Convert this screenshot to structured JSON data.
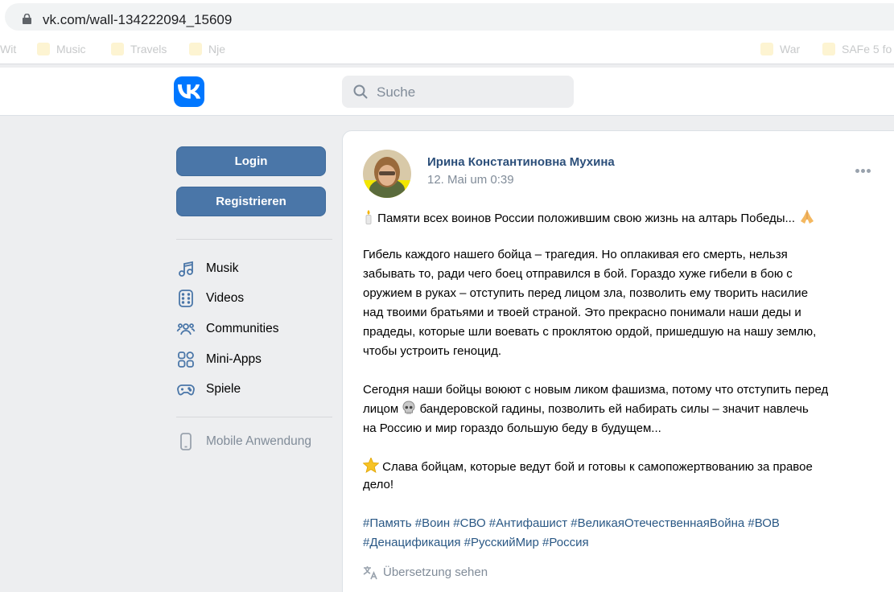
{
  "browser": {
    "url": "vk.com/wall-134222094_15609",
    "bookmarks": [
      "Wit",
      "Music",
      "Travels",
      "Nje",
      "War",
      "SAFe 5 fo"
    ]
  },
  "header": {
    "logo_icon": "vk-logo-icon",
    "search_placeholder": "Suche",
    "brand_color": "#0077ff"
  },
  "sidebar": {
    "login_label": "Login",
    "register_label": "Registrieren",
    "items": [
      {
        "label": "Musik",
        "icon": "music-note-icon"
      },
      {
        "label": "Videos",
        "icon": "video-icon"
      },
      {
        "label": "Communities",
        "icon": "people-icon"
      },
      {
        "label": "Mini-Apps",
        "icon": "apps-grid-icon"
      },
      {
        "label": "Spiele",
        "icon": "gamepad-icon"
      }
    ],
    "mobile_label": "Mobile Anwendung"
  },
  "post": {
    "author": "Ирина Константиновна Мухина",
    "date": "12. Mai um 0:39",
    "lines": {
      "l1": "Памяти всех воинов России положившим свою жизнь на алтарь Победы...",
      "p2_1": "Гибель каждого нашего бойца – трагедия. Но оплакивая его смерть, нельзя",
      "p2_2": "забывать то, ради чего боец отправился в бой. Гораздо хуже гибели в бою с",
      "p2_3": "оружием в руках – отступить перед лицом зла, позволить ему творить насилие",
      "p2_4": "над твоими братьями и твоей страной. Это прекрасно понимали наши деды и",
      "p2_5": "прадеды, которые шли воевать с проклятою ордой, пришедшую на нашу землю,",
      "p2_6": "чтобы устроить геноцид.",
      "p3_1": "Сегодня наши бойцы воюют с новым ликом фашизма, потому что отступить перед",
      "p3_2a": "лицом",
      "p3_2b": "бандеровской гадины, позволить ей набирать силы – значит навлечь",
      "p3_3": "на Россию и мир гораздо большую беду в будущем...",
      "p4_1": "Слава бойцам, которые ведут бой и готовы к самопожертвованию за правое",
      "p4_2": "дело!"
    },
    "hashtags_line1": "#Память #Воин #СВО #Антифашист #ВеликаяОтечественнаяВойна #ВОВ",
    "hashtags_line2": "#Денацификация #РусскийМир #Россия",
    "translate_label": "Übersetzung sehen",
    "link_color": "#2a5885"
  }
}
